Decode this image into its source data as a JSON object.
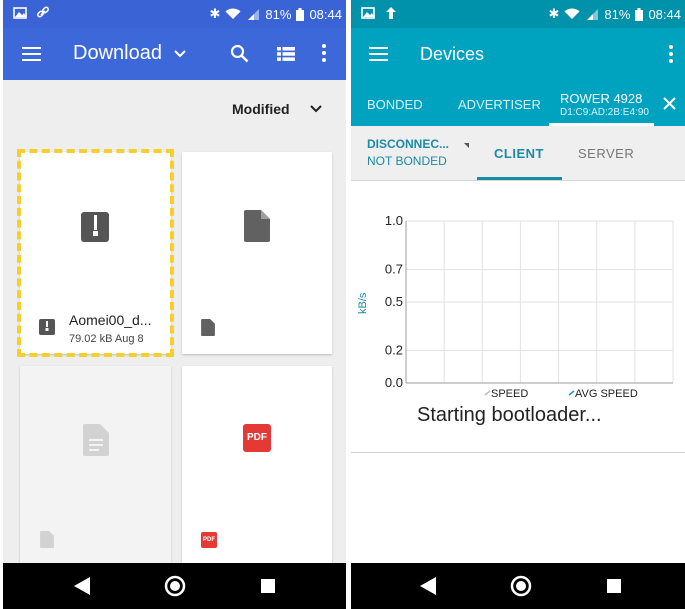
{
  "left_phone": {
    "status": {
      "battery": "81%",
      "time": "08:44"
    },
    "appbar": {
      "title": "Download"
    },
    "sort": {
      "label": "Modified"
    },
    "files": [
      {
        "name": "Aomei00_d...",
        "meta": "79.02 kB Aug 8",
        "type": "archive"
      },
      {
        "name": "",
        "meta": "",
        "type": "file"
      },
      {
        "name": "",
        "meta": "",
        "type": "document"
      },
      {
        "name": "",
        "meta": "",
        "type": "pdf",
        "badge": "PDF"
      }
    ]
  },
  "right_phone": {
    "status": {
      "battery": "81%",
      "time": "08:44"
    },
    "appbar": {
      "title": "Devices"
    },
    "tabs": [
      {
        "label": "BONDED"
      },
      {
        "label": "ADVERTISER"
      },
      {
        "label": "ROWER 4928",
        "sub": "D1:C9:AD:2B:E4:90"
      }
    ],
    "device": {
      "status": "DISCONNEC...",
      "bond": "NOT BONDED"
    },
    "subtabs": [
      {
        "label": "CLIENT"
      },
      {
        "label": "SERVER"
      }
    ],
    "chart_data": {
      "type": "line",
      "ylabel": "kB/s",
      "ylim": [
        0,
        1.0
      ],
      "yticks": [
        "1.0",
        "0.7",
        "0.5",
        "0.2",
        "0.0"
      ],
      "series": [
        {
          "name": "SPEED",
          "values": []
        },
        {
          "name": "AVG SPEED",
          "values": []
        }
      ],
      "grid": true
    },
    "message": "Starting bootloader..."
  },
  "colors": {
    "blue_bar": "#3d68da",
    "teal_bar": "#00a3bf",
    "highlight": "#f6cf2a",
    "pdf_red": "#e53935"
  }
}
